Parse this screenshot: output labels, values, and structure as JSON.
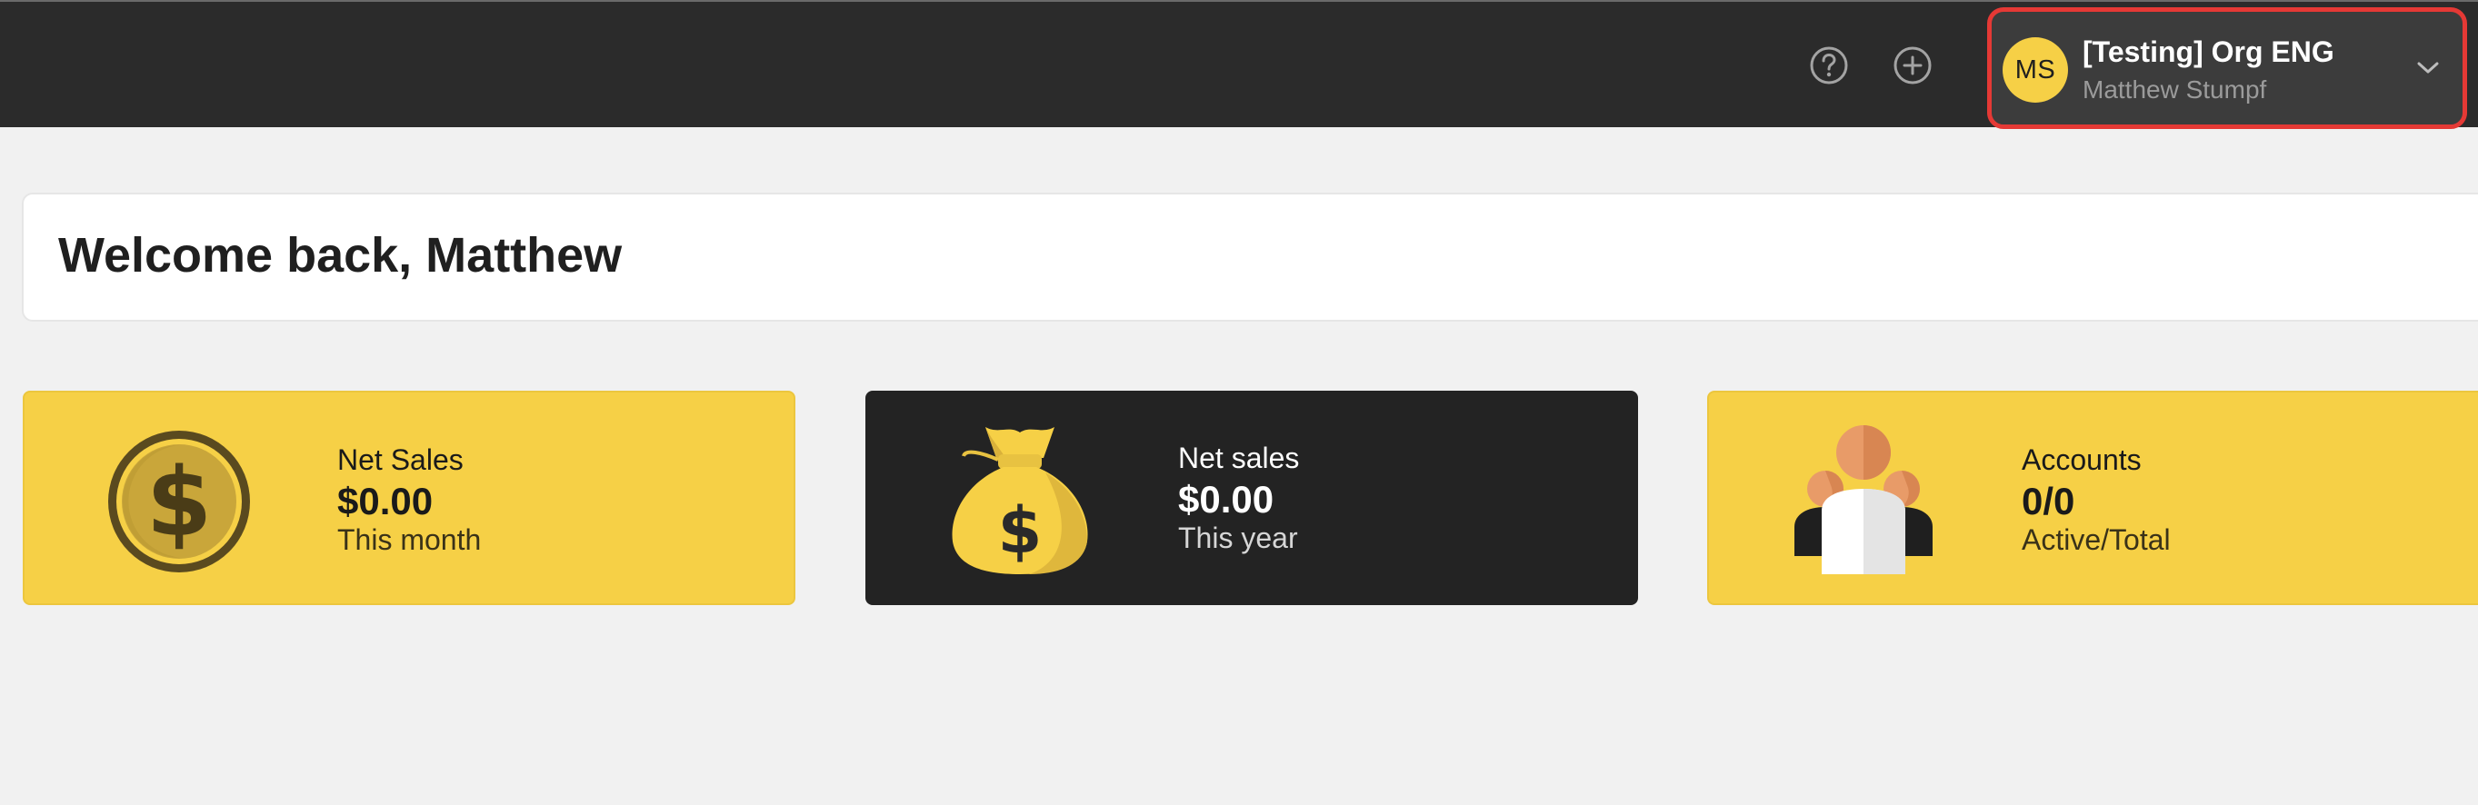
{
  "header": {
    "help_icon": "question-circle-icon",
    "add_icon": "plus-circle-icon",
    "user_menu": {
      "avatar_initials": "MS",
      "org_name": "[Testing] Org ENG",
      "user_name": "Matthew Stumpf",
      "chevron_icon": "chevron-down-icon"
    }
  },
  "welcome": {
    "title": "Welcome back, Matthew"
  },
  "cards": [
    {
      "icon": "dollar-coin-icon",
      "title": "Net Sales",
      "value": "$0.00",
      "subtitle": "This month",
      "theme": "yellow"
    },
    {
      "icon": "money-bag-icon",
      "title": "Net sales",
      "value": "$0.00",
      "subtitle": "This year",
      "theme": "dark"
    },
    {
      "icon": "users-group-icon",
      "title": "Accounts",
      "value": "0/0",
      "subtitle": "Active/Total",
      "theme": "yellow"
    }
  ],
  "colors": {
    "topbar": "#2b2b2b",
    "accent_yellow": "#f6d046",
    "card_dark": "#232323",
    "highlight_outline": "#e53935",
    "page_background": "#f1f1f1"
  }
}
